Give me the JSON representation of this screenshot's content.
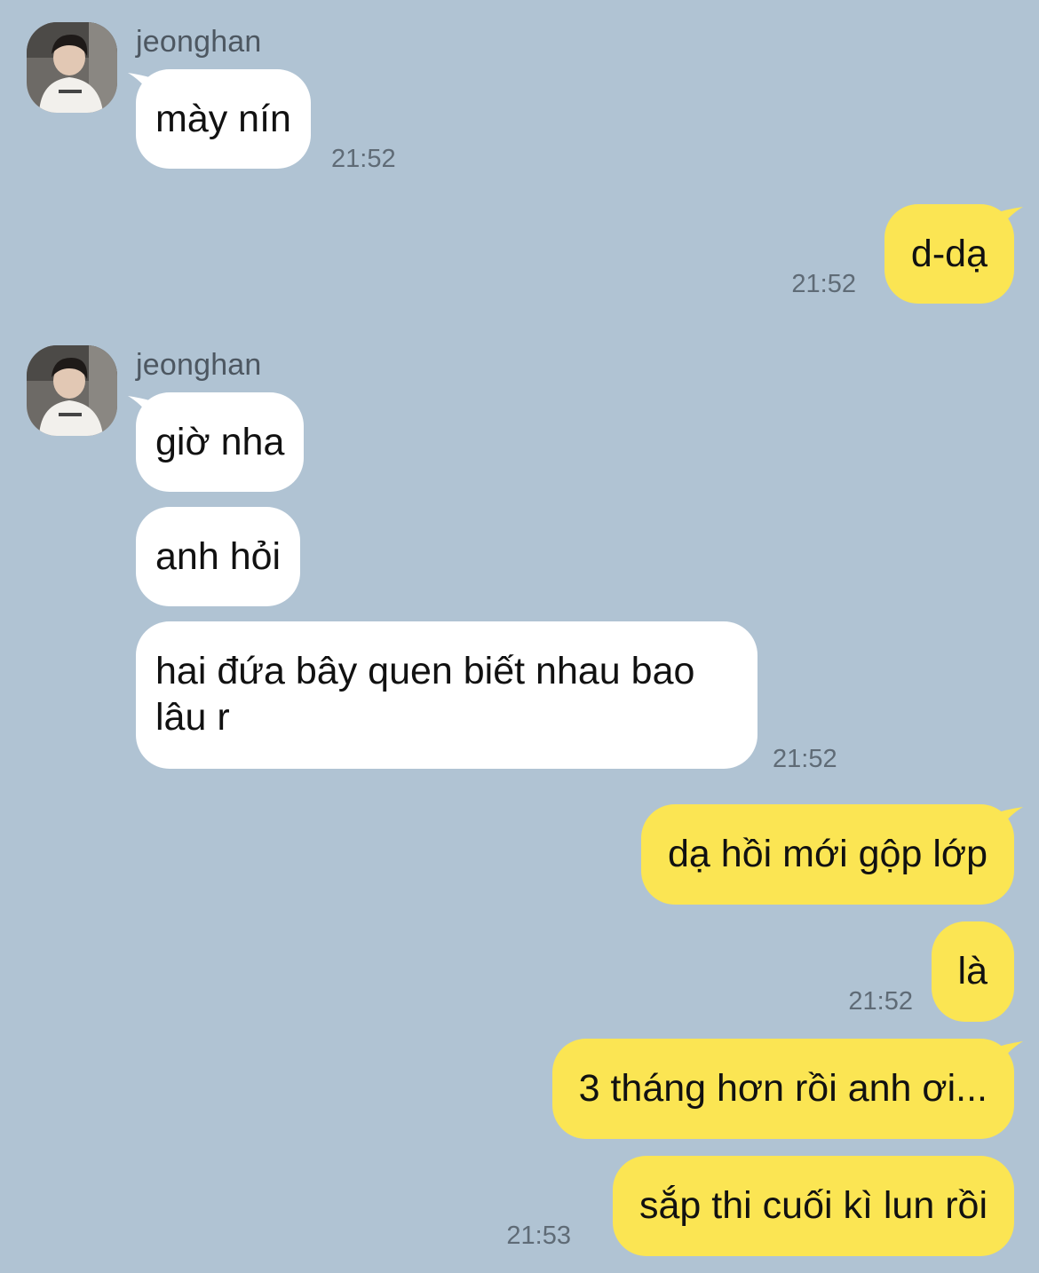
{
  "contact": {
    "name": "jeonghan"
  },
  "colors": {
    "background": "#b0c3d3",
    "incoming_bubble": "#ffffff",
    "outgoing_bubble": "#fbe553"
  },
  "messages": [
    {
      "id": "m1",
      "direction": "incoming",
      "text": "mày nín",
      "time": "21:52"
    },
    {
      "id": "m2",
      "direction": "outgoing",
      "text": "d-dạ",
      "time": "21:52"
    },
    {
      "id": "m3",
      "direction": "incoming",
      "text": "giờ nha"
    },
    {
      "id": "m4",
      "direction": "incoming",
      "text": "anh hỏi"
    },
    {
      "id": "m5",
      "direction": "incoming",
      "text": "hai đứa bây quen biết nhau bao lâu r",
      "time": "21:52"
    },
    {
      "id": "m6",
      "direction": "outgoing",
      "text": "dạ hồi mới gộp lớp"
    },
    {
      "id": "m7",
      "direction": "outgoing",
      "text": "là",
      "time": "21:52"
    },
    {
      "id": "m8",
      "direction": "outgoing",
      "text": "3 tháng hơn rồi anh ơi..."
    },
    {
      "id": "m9",
      "direction": "outgoing",
      "text": "sắp thi cuối kì lun rồi",
      "time": "21:53"
    }
  ]
}
